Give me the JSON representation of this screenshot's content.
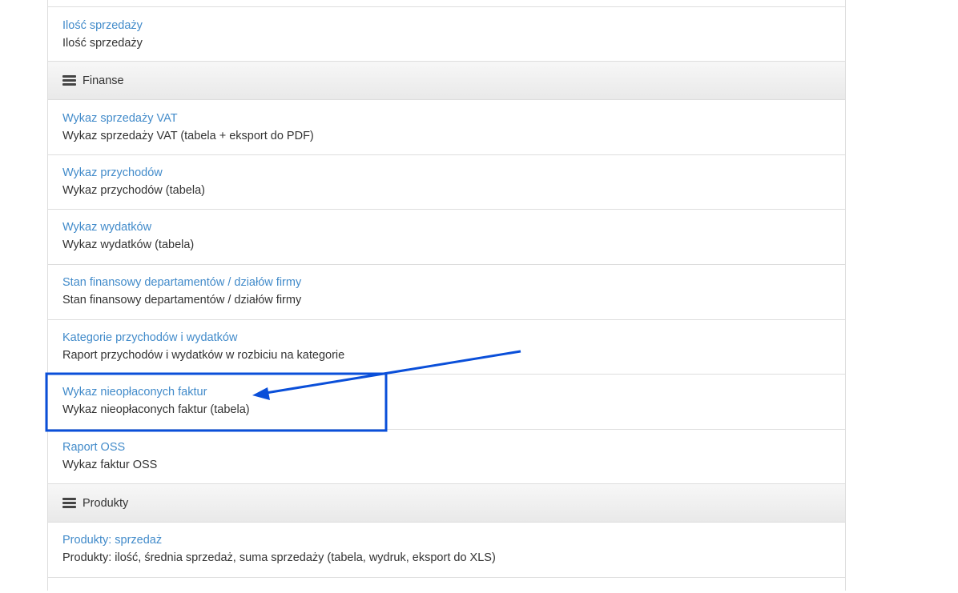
{
  "top_item": {
    "link": "Ilość sprzedaży",
    "desc": "Ilość sprzedaży"
  },
  "groups": {
    "finanse": {
      "label": "Finanse",
      "icon": "hamburger-icon"
    },
    "produkty": {
      "label": "Produkty",
      "icon": "hamburger-icon"
    }
  },
  "finanse_items": [
    {
      "link": "Wykaz sprzedaży VAT",
      "desc": "Wykaz sprzedaży VAT (tabela + eksport do PDF)"
    },
    {
      "link": "Wykaz przychodów",
      "desc": "Wykaz przychodów (tabela)"
    },
    {
      "link": "Wykaz wydatków",
      "desc": "Wykaz wydatków (tabela)"
    },
    {
      "link": "Stan finansowy departamentów / działów firmy",
      "desc": "Stan finansowy departamentów / działów firmy"
    },
    {
      "link": "Kategorie przychodów i wydatków",
      "desc": "Raport przychodów i wydatków w rozbiciu na kategorie"
    },
    {
      "link": "Wykaz nieopłaconych faktur",
      "desc": "Wykaz nieopłaconych faktur (tabela)"
    },
    {
      "link": "Raport OSS",
      "desc": "Wykaz faktur OSS"
    }
  ],
  "produkty_items": [
    {
      "link": "Produkty: sprzedaż",
      "desc": "Produkty: ilość, średnia sprzedaż, suma sprzedaży (tabela, wydruk, eksport do XLS)"
    }
  ],
  "colors": {
    "link": "#428bca",
    "annotation": "#0a4fd9",
    "border": "#dddddd"
  }
}
